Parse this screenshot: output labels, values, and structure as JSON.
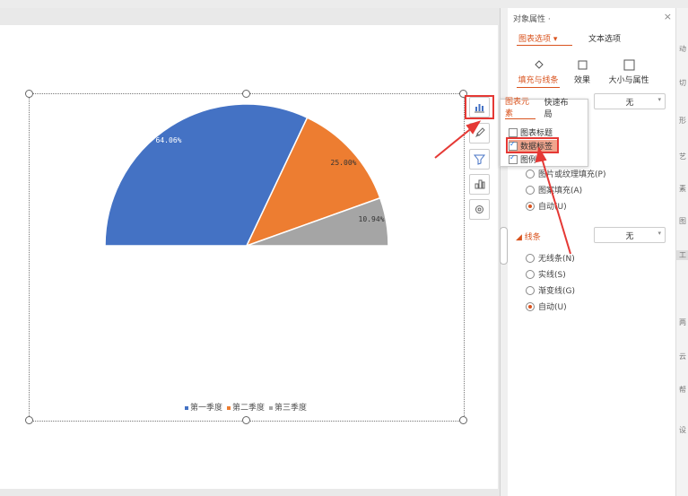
{
  "chart_data": {
    "type": "pie",
    "title": "",
    "layout": "half-pie (upper semicircle)",
    "categories": [
      "第一季度",
      "第二季度",
      "第三季度"
    ],
    "values": [
      64.06,
      25.0,
      10.94
    ],
    "data_labels": [
      "64.06%",
      "25.00%",
      "10.94%"
    ],
    "colors": [
      "#4472C4",
      "#ED7D31",
      "#A5A5A5"
    ],
    "legend": "bottom"
  },
  "legend": {
    "items": [
      "第一季度",
      "第二季度",
      "第三季度"
    ]
  },
  "popup": {
    "tab_elements": "图表元素",
    "tab_quick": "快速布局",
    "items": [
      {
        "label": "图表标题",
        "checked": false
      },
      {
        "label": "数据标签",
        "checked": true
      },
      {
        "label": "图例",
        "checked": true
      }
    ]
  },
  "panel": {
    "title": "对象属性 ·",
    "close": "×",
    "tab_chart_options": "图表选项",
    "tab_text_options": "文本选项",
    "sub_fill_line": "填充与线条",
    "sub_effect": "效果",
    "sub_size_props": "大小与属性",
    "fill_dropdown": "无",
    "fill_options": [
      {
        "label": "图片或纹理填充(P)",
        "selected": false
      },
      {
        "label": "图案填充(A)",
        "selected": false
      },
      {
        "label": "自动(U)",
        "selected": true
      }
    ],
    "line_section": "线条",
    "line_dropdown": "无",
    "line_options": [
      {
        "label": "无线条(N)",
        "selected": false
      },
      {
        "label": "实线(S)",
        "selected": false
      },
      {
        "label": "渐变线(G)",
        "selected": false
      },
      {
        "label": "自动(U)",
        "selected": true
      }
    ]
  },
  "rail": [
    "动",
    "切",
    "形",
    "艺",
    "素",
    "图",
    "工",
    "",
    "两",
    "云",
    "帮",
    "设"
  ]
}
